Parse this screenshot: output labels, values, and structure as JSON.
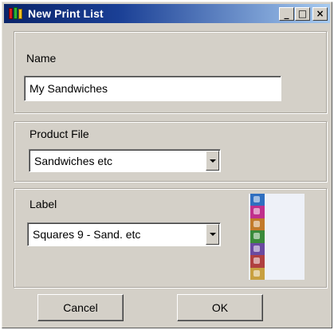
{
  "window": {
    "title": "New Print List",
    "minimize_glyph": "_",
    "maximize_glyph": "□",
    "close_glyph": "×"
  },
  "name_group": {
    "label": "Name",
    "value": "My Sandwiches"
  },
  "product_group": {
    "label": "Product File",
    "selected": "Sandwiches etc"
  },
  "label_group": {
    "label": "Label",
    "selected": "Squares 9 - Sand. etc",
    "preview_icon": "label-preview-icon",
    "preview_colors": [
      "#2f6fc0",
      "#c0308c",
      "#c27a2a",
      "#3a8a3a",
      "#6a4aa0",
      "#b04040",
      "#c8a040"
    ]
  },
  "footer": {
    "cancel_label": "Cancel",
    "ok_label": "OK"
  }
}
